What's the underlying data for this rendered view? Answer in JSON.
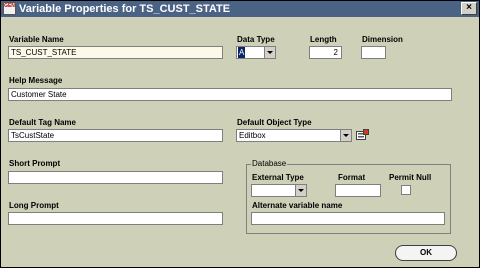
{
  "window": {
    "title": "Variable Properties for TS_CUST_STATE",
    "close_glyph": "×",
    "app_icon_text": "GEN"
  },
  "fields": {
    "variable_name": {
      "label": "Variable Name",
      "value": "TS_CUST_STATE"
    },
    "data_type": {
      "label": "Data Type",
      "value": "A"
    },
    "length": {
      "label": "Length",
      "value": "2"
    },
    "dimension": {
      "label": "Dimension",
      "value": ""
    },
    "help_message": {
      "label": "Help Message",
      "value": "Customer State"
    },
    "default_tag_name": {
      "label": "Default Tag Name",
      "value": "TsCustState"
    },
    "default_object_type": {
      "label": "Default Object Type",
      "value": "Editbox"
    },
    "short_prompt": {
      "label": "Short Prompt",
      "value": ""
    },
    "long_prompt": {
      "label": "Long Prompt",
      "value": ""
    }
  },
  "database": {
    "title": "Database",
    "external_type": {
      "label": "External Type",
      "value": ""
    },
    "format": {
      "label": "Format",
      "value": ""
    },
    "permit_null": {
      "label": "Permit Null",
      "checked": false
    },
    "alternate_variable_name": {
      "label": "Alternate variable name",
      "value": ""
    }
  },
  "buttons": {
    "ok": "OK"
  },
  "colors": {
    "title_bar": "#4a6283",
    "dialog_background": "#cfd0b8",
    "selection": "#0a246a"
  }
}
